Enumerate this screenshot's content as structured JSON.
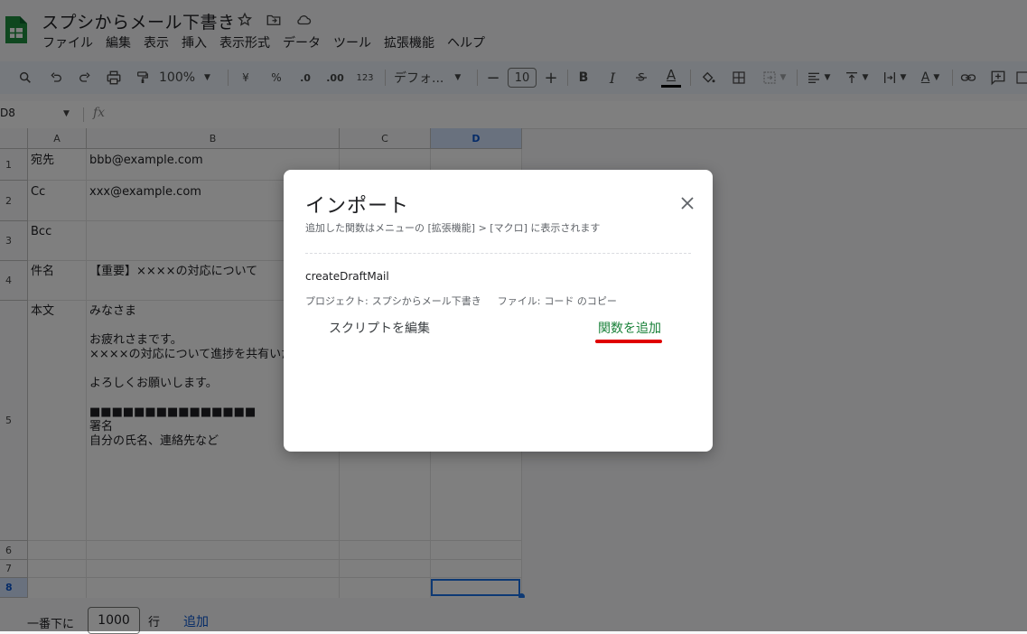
{
  "header": {
    "doc_title": "スプシからメール下書き",
    "menu": [
      "ファイル",
      "編集",
      "表示",
      "挿入",
      "表示形式",
      "データ",
      "ツール",
      "拡張機能",
      "ヘルプ"
    ]
  },
  "toolbar": {
    "zoom": "100%",
    "currency": "¥",
    "percent": "%",
    "decrease_decimal": ".0",
    "increase_decimal": ".00",
    "number_format": "123",
    "font": "デフォ...",
    "font_size": "10",
    "bold": "B",
    "italic": "I",
    "text_color": "A",
    "wrap_text": "A"
  },
  "formula_bar": {
    "name_box": "D8",
    "fx": "fx"
  },
  "grid": {
    "columns": [
      "A",
      "B",
      "C",
      "D"
    ],
    "rows": [
      "1",
      "2",
      "3",
      "4",
      "5",
      "6",
      "7",
      "8"
    ],
    "cells": {
      "a1": "宛先",
      "b1": "bbb@example.com",
      "a2": "Cc",
      "b2": "xxx@example.com",
      "a3": "Bcc",
      "a4": "件名",
      "b4": "【重要】××××の対応について",
      "a5": "本文",
      "b5": "みなさま\n\nお疲れさまです。\n××××の対応について進捗を共有いた\n\nよろしくお願いします。\n\n■■■■■■■■■■■■■■■\n署名\n自分の氏名、連絡先など"
    }
  },
  "bottom": {
    "prefix": "一番下に",
    "row_count": "1000",
    "suffix": "行",
    "add_label": "追加"
  },
  "dialog": {
    "title": "インポート",
    "subtitle": "追加した関数はメニューの [拡張機能] > [マクロ] に表示されます",
    "function_name": "createDraftMail",
    "project_label": "プロジェクト:",
    "project_value": "スプシからメール下書き",
    "file_label": "ファイル:",
    "file_value": "コード のコピー",
    "edit_script": "スクリプトを編集",
    "add_function": "関数を追加"
  },
  "colors": {
    "accent_green": "#188038",
    "highlight_red": "#e00000",
    "selection_blue": "#1a73e8"
  }
}
